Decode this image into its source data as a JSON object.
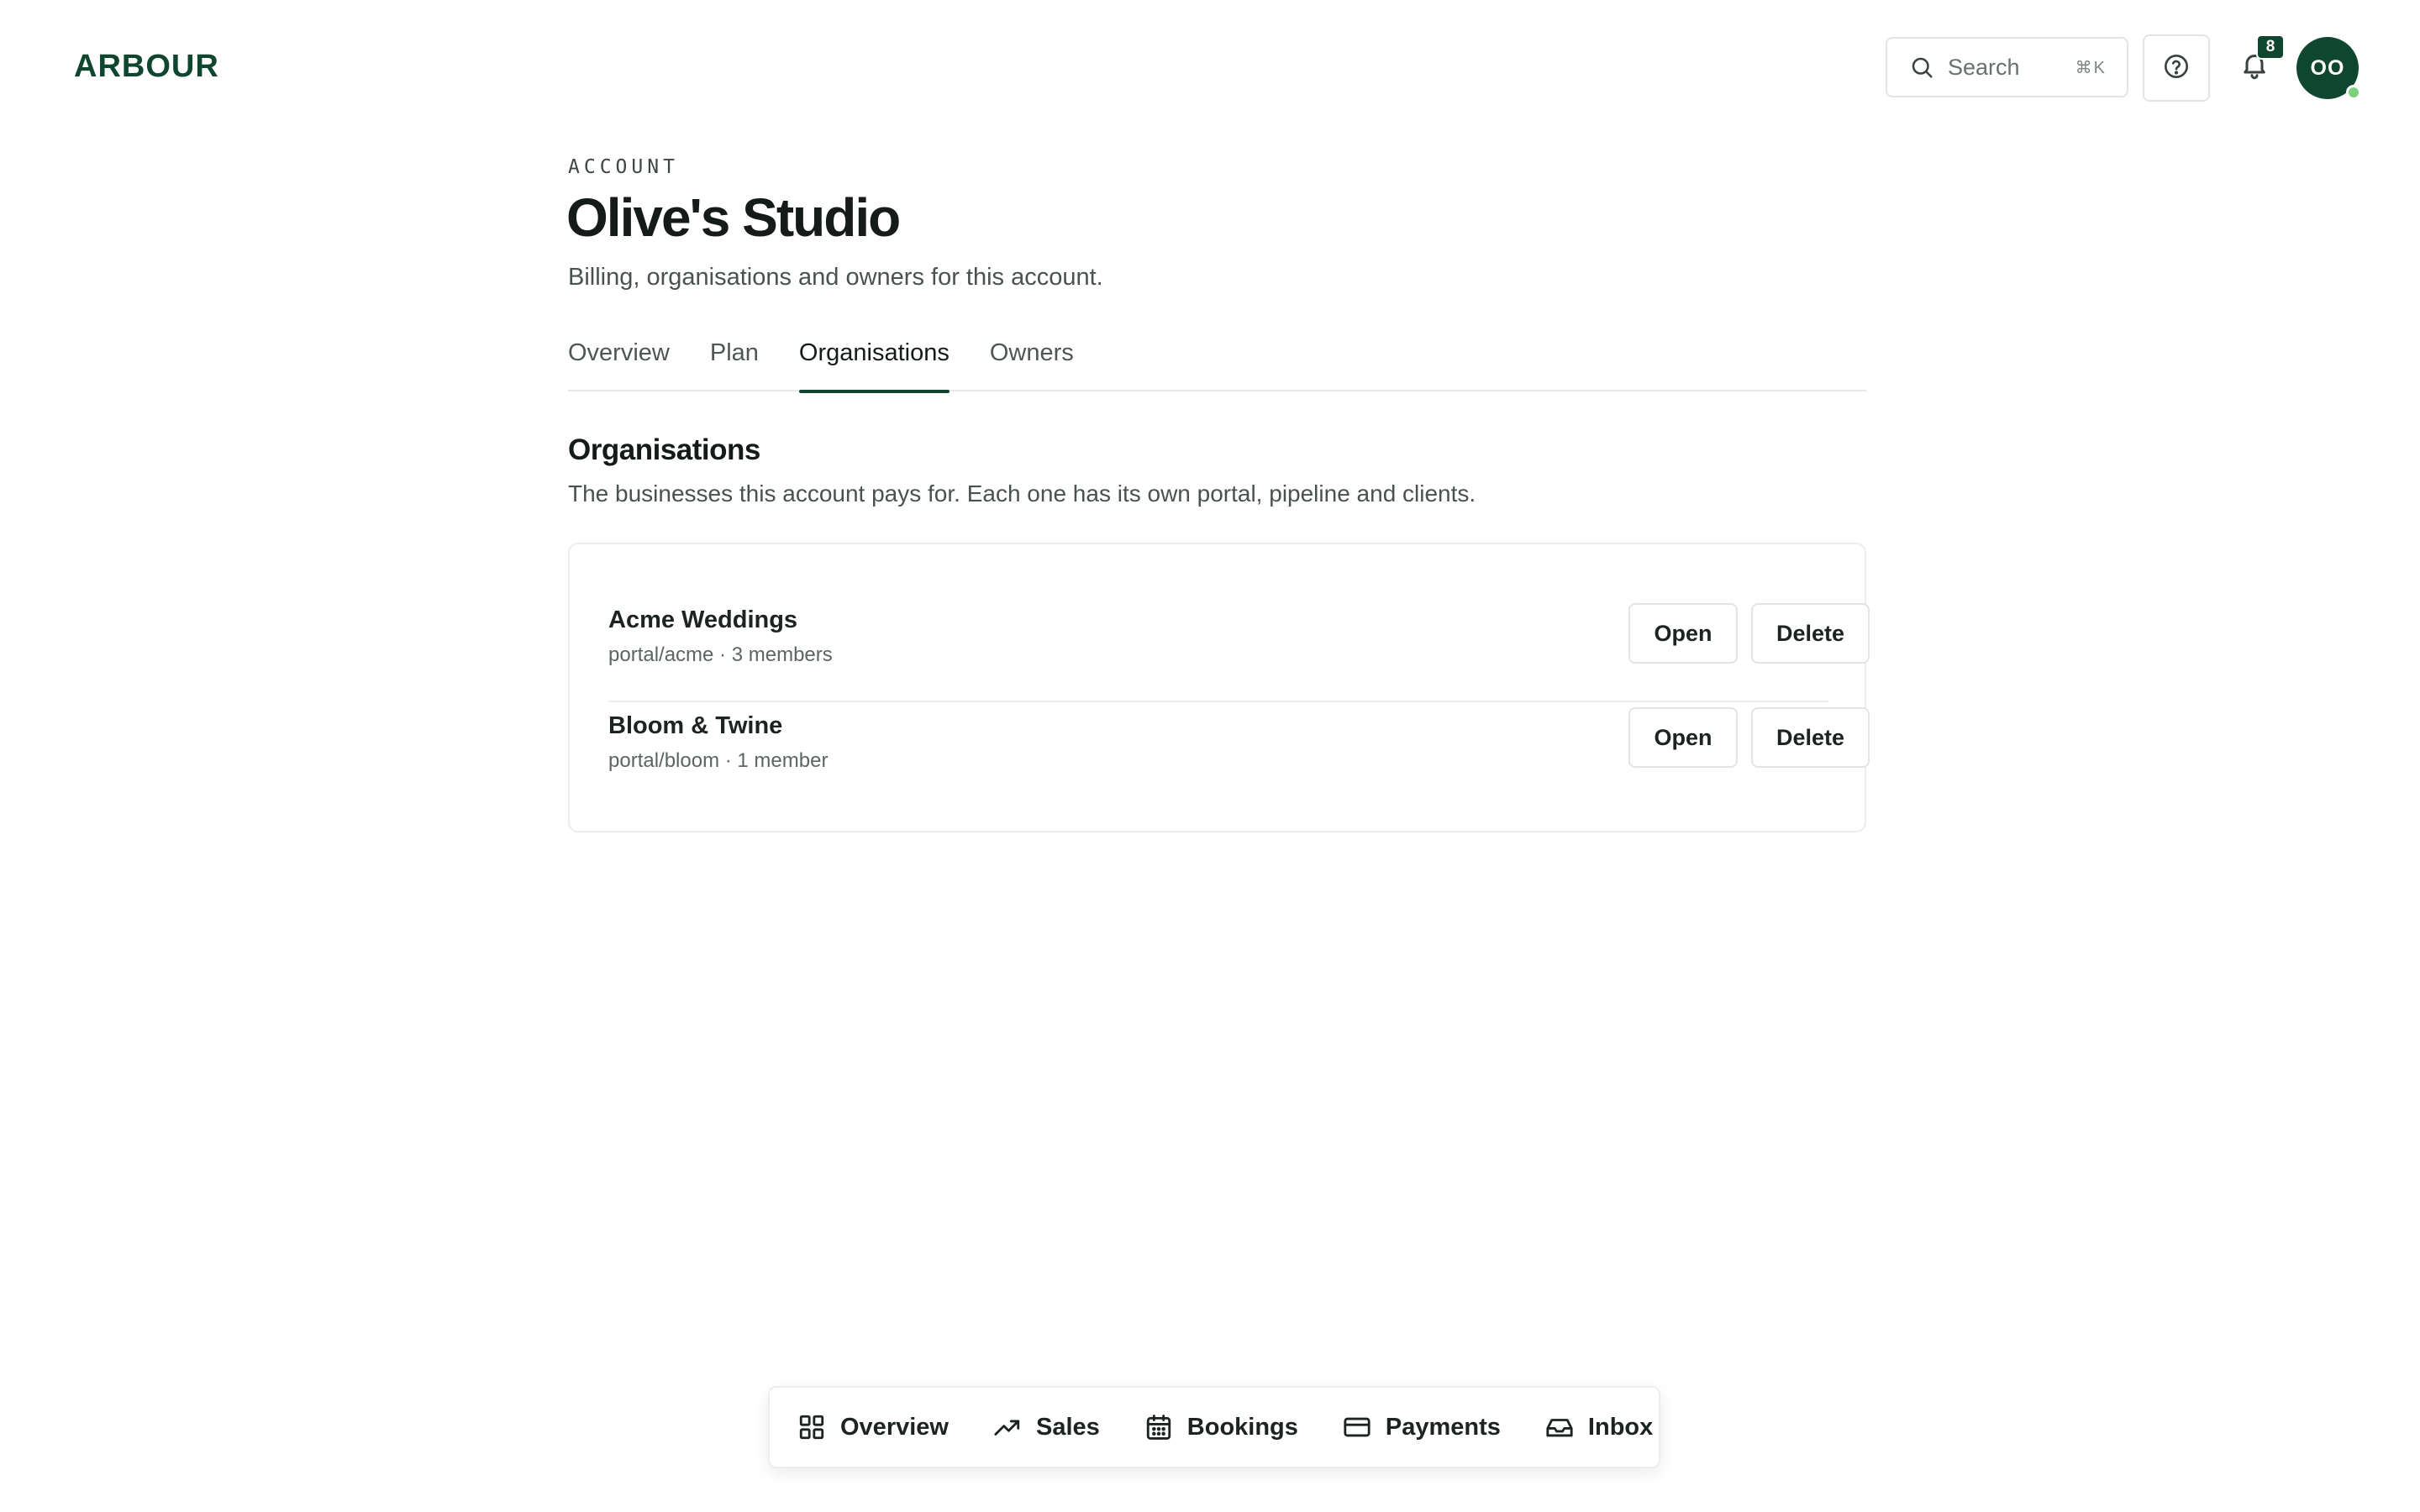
{
  "header": {
    "logo": "ARBOUR",
    "search": {
      "placeholder": "Search",
      "shortcut": "⌘K",
      "icon": "search-icon"
    },
    "help_icon": "help-circle-icon",
    "notifications": {
      "icon": "bell-icon",
      "count": "8"
    },
    "avatar": {
      "initials": "OO",
      "status_color": "#7ed07a"
    }
  },
  "page": {
    "eyebrow": "ACCOUNT",
    "title": "Olive's Studio",
    "subtitle": "Billing, organisations and owners for this account."
  },
  "tabs": [
    {
      "label": "Overview",
      "active": false
    },
    {
      "label": "Plan",
      "active": false
    },
    {
      "label": "Organisations",
      "active": true
    },
    {
      "label": "Owners",
      "active": false
    }
  ],
  "section": {
    "title": "Organisations",
    "description": "The businesses this account pays for. Each one has its own portal, pipeline and clients."
  },
  "organisations": [
    {
      "name": "Acme Weddings",
      "meta": "portal/acme · 3 members",
      "open_label": "Open",
      "delete_label": "Delete"
    },
    {
      "name": "Bloom & Twine",
      "meta": "portal/bloom · 1 member",
      "open_label": "Open",
      "delete_label": "Delete"
    }
  ],
  "bottom_nav": [
    {
      "label": "Overview",
      "icon": "grid-icon"
    },
    {
      "label": "Sales",
      "icon": "trending-up-icon"
    },
    {
      "label": "Bookings",
      "icon": "calendar-icon"
    },
    {
      "label": "Payments",
      "icon": "credit-card-icon"
    },
    {
      "label": "Inbox",
      "icon": "inbox-icon"
    }
  ],
  "colors": {
    "brand": "#0f4630",
    "border": "#e2e5e3",
    "text": "#1c2321",
    "muted": "#4a524f"
  }
}
